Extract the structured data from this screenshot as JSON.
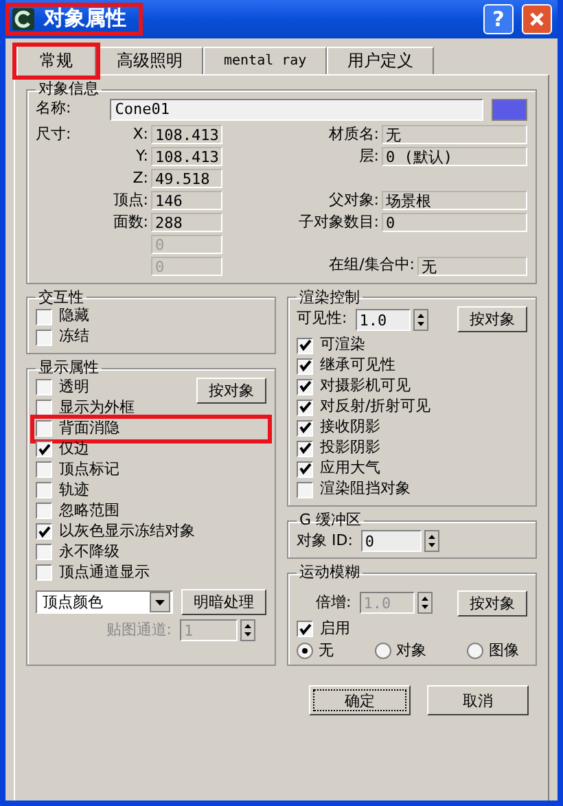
{
  "window": {
    "title": "对象属性",
    "highlighted": true,
    "buttons": [
      {
        "kind": "help",
        "label": "?"
      },
      {
        "kind": "close"
      }
    ]
  },
  "tabs": [
    {
      "label": "常规",
      "selected": true,
      "highlighted": true
    },
    {
      "label": "高级照明",
      "selected": false,
      "highlighted": false
    },
    {
      "label": "mental ray",
      "selected": false,
      "highlighted": false
    },
    {
      "label": "用户定义",
      "selected": false,
      "highlighted": false
    }
  ],
  "object_info": {
    "title": "对象信息",
    "name_label": "名称:",
    "name_value": "Cone01",
    "color": "#5a5ae6",
    "dimensions_label": "尺寸:",
    "rows": [
      {
        "left": {
          "label": "X:",
          "value": "108.413",
          "disabled": false
        },
        "right": {
          "label": "材质名:",
          "value": "无"
        }
      },
      {
        "left": {
          "label": "Y:",
          "value": "108.413",
          "disabled": false
        },
        "right": {
          "label": "层:",
          "value": "0 (默认)"
        }
      },
      {
        "left": {
          "label": "Z:",
          "value": "49.518",
          "disabled": false
        }
      },
      {
        "left": {
          "label": "顶点:",
          "value": "146",
          "disabled": false
        },
        "right": {
          "label": "父对象:",
          "value": "场景根"
        }
      },
      {
        "left": {
          "label": "面数:",
          "value": "288",
          "disabled": false
        },
        "right": {
          "label": "子对象数目:",
          "value": "0"
        }
      },
      {
        "left": {
          "value": "0",
          "disabled": true
        }
      },
      {
        "left": {
          "value": "0",
          "disabled": true
        },
        "right": {
          "label": "在组/集合中:",
          "value": "无",
          "wide": true
        }
      }
    ]
  },
  "interactivity": {
    "title": "交互性",
    "options": [
      {
        "label": "隐藏",
        "checked": false
      },
      {
        "label": "冻结",
        "checked": false
      }
    ]
  },
  "display": {
    "title": "显示属性",
    "button": "按对象",
    "options": [
      {
        "label": "透明",
        "checked": false,
        "highlighted": false
      },
      {
        "label": "显示为外框",
        "checked": false,
        "highlighted": false
      },
      {
        "label": "背面消隐",
        "checked": false,
        "highlighted": true
      },
      {
        "label": "仅边",
        "checked": true,
        "highlighted": false
      },
      {
        "label": "顶点标记",
        "checked": false,
        "highlighted": false
      },
      {
        "label": "轨迹",
        "checked": false,
        "highlighted": false
      },
      {
        "label": "忽略范围",
        "checked": false,
        "highlighted": false
      },
      {
        "label": "以灰色显示冻结对象",
        "checked": true,
        "highlighted": false
      },
      {
        "label": "永不降级",
        "checked": false,
        "highlighted": false
      },
      {
        "label": "顶点通道显示",
        "checked": false,
        "highlighted": false
      }
    ],
    "dropdown": {
      "value": "顶点颜色"
    },
    "shade_button": "明暗处理",
    "map_channel": {
      "label": "贴图通道:",
      "value": "1",
      "disabled": true
    }
  },
  "render": {
    "title": "渲染控制",
    "visibility": {
      "label": "可见性:",
      "value": "1.0"
    },
    "button": "按对象",
    "options": [
      {
        "label": "可渲染",
        "checked": true
      },
      {
        "label": "继承可见性",
        "checked": true
      },
      {
        "label": "对摄影机可见",
        "checked": true
      },
      {
        "label": "对反射/折射可见",
        "checked": true
      },
      {
        "label": "接收阴影",
        "checked": true
      },
      {
        "label": "投影阴影",
        "checked": true
      },
      {
        "label": "应用大气",
        "checked": true
      },
      {
        "label": "渲染阻挡对象",
        "checked": false
      }
    ]
  },
  "gbuffer": {
    "title": "G 缓冲区",
    "object_id": {
      "label": "对象 ID:",
      "value": "0"
    }
  },
  "motion_blur": {
    "title": "运动模糊",
    "multiplier": {
      "label": "倍增:",
      "value": "1.0",
      "disabled": true
    },
    "button": "按对象",
    "enabled": {
      "label": "启用",
      "checked": true
    },
    "modes": [
      {
        "label": "无",
        "selected": true
      },
      {
        "label": "对象",
        "selected": false
      },
      {
        "label": "图像",
        "selected": false
      }
    ]
  },
  "footer": [
    {
      "label": "确定",
      "focused": true
    },
    {
      "label": "取消",
      "focused": false
    }
  ]
}
